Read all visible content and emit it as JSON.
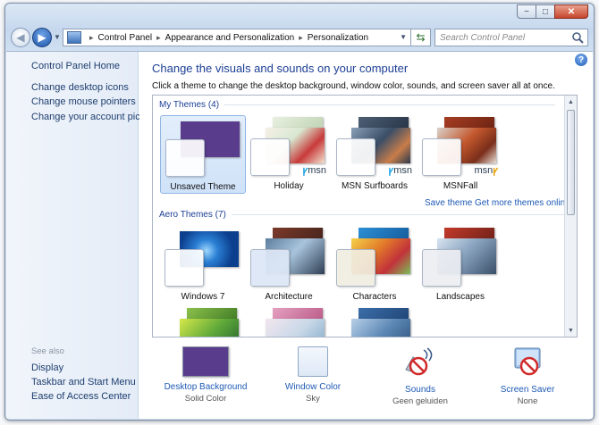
{
  "window": {
    "controls": {
      "minimize": "−",
      "maximize": "□",
      "close": "✕"
    }
  },
  "navbar": {
    "breadcrumbs": [
      "Control Panel",
      "Appearance and Personalization",
      "Personalization"
    ],
    "search_placeholder": "Search Control Panel"
  },
  "sidebar": {
    "home": "Control Panel Home",
    "links": [
      "Change desktop icons",
      "Change mouse pointers",
      "Change your account picture"
    ],
    "see_also_title": "See also",
    "see_also": [
      "Display",
      "Taskbar and Start Menu",
      "Ease of Access Center"
    ]
  },
  "main": {
    "help": "?",
    "heading": "Change the visuals and sounds on your computer",
    "subtext": "Click a theme to change the desktop background, window color, sounds, and screen saver all at once.",
    "my_themes_title": "My Themes (4)",
    "my_themes": [
      {
        "label": "Unsaved Theme",
        "brand": ""
      },
      {
        "label": "Holiday",
        "brand": "msn"
      },
      {
        "label": "MSN Surfboards",
        "brand": "msn"
      },
      {
        "label": "MSNFall",
        "brand": "msn"
      }
    ],
    "save_theme": "Save theme",
    "get_more": "Get more themes online",
    "aero_title": "Aero Themes (7)",
    "aero_themes": [
      {
        "label": "Windows 7"
      },
      {
        "label": "Architecture"
      },
      {
        "label": "Characters"
      },
      {
        "label": "Landscapes"
      }
    ]
  },
  "bottom": {
    "items": [
      {
        "link": "Desktop Background",
        "value": "Solid Color"
      },
      {
        "link": "Window Color",
        "value": "Sky"
      },
      {
        "link": "Sounds",
        "value": "Geen geluiden"
      },
      {
        "link": "Screen Saver",
        "value": "None"
      }
    ]
  },
  "colors": {
    "link": "#1e5ab4",
    "heading": "#1c3f95",
    "unsaved_bg": "#5a3c8c"
  }
}
